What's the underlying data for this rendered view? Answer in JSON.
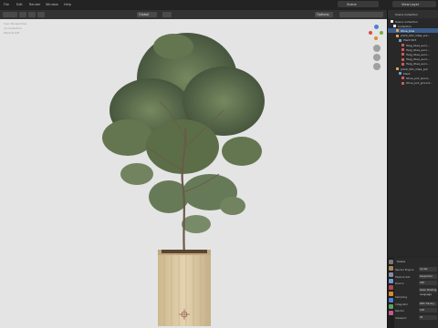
{
  "topbar": {
    "menus": [
      "File",
      "Edit",
      "Render",
      "Window",
      "Help"
    ],
    "view_layer": "View Layer",
    "scene": "Scene"
  },
  "viewport": {
    "mode": "Object Mode",
    "shading": "Global",
    "overlays": "Options",
    "info_lines": [
      "User Perspective",
      "(1) Collection",
      "Objects 0/8"
    ]
  },
  "outliner": {
    "title": "Scene Collection",
    "rows": [
      {
        "label": "Scene Collection",
        "icon": "collection-icon",
        "indent": 1,
        "selected": false
      },
      {
        "label": "Collection",
        "icon": "collection-icon",
        "indent": 2,
        "selected": false
      },
      {
        "label": "Olive_tree",
        "icon": "object-icon",
        "indent": 3,
        "selected": true
      },
      {
        "label": "plant_001_Olea_eur...",
        "icon": "object-icon",
        "indent": 3,
        "selected": false
      },
      {
        "label": "Plant 003",
        "icon": "mesh-icon",
        "indent": 4,
        "selected": false
      },
      {
        "label": "Twig_Olea_euro...",
        "icon": "material-icon",
        "indent": 5,
        "selected": false
      },
      {
        "label": "Twig_Olea_euro...",
        "icon": "material-icon",
        "indent": 5,
        "selected": false
      },
      {
        "label": "Twig_Olea_euro...",
        "icon": "material-icon",
        "indent": 5,
        "selected": false
      },
      {
        "label": "Twig_Olea_euro...",
        "icon": "material-icon",
        "indent": 5,
        "selected": false
      },
      {
        "label": "Twig_Olea_euro...",
        "icon": "material-icon",
        "indent": 5,
        "selected": false
      },
      {
        "label": "plant_001_Olea_pot",
        "icon": "object-icon",
        "indent": 3,
        "selected": false
      },
      {
        "label": "Plant",
        "icon": "mesh-icon",
        "indent": 4,
        "selected": false
      },
      {
        "label": "Olive_pot_wood...",
        "icon": "material-icon",
        "indent": 5,
        "selected": false
      },
      {
        "label": "Olive_pot_ground...",
        "icon": "material-icon",
        "indent": 5,
        "selected": false
      }
    ]
  },
  "properties": {
    "header": "Scene",
    "rows": [
      {
        "label": "Render Engine",
        "value": "Cycles"
      },
      {
        "label": "Feature Set",
        "value": "Supported"
      },
      {
        "label": "Device",
        "value": "CPU"
      },
      {
        "label": "",
        "value": "Open Shading Language"
      },
      {
        "label": "Sampling",
        "value": ""
      },
      {
        "label": "Integrator",
        "value": "Path Tracing"
      },
      {
        "label": "Render",
        "value": "128"
      },
      {
        "label": "Viewport",
        "value": "32"
      }
    ]
  },
  "colors": {
    "viewport_bg": "#e4e4e4",
    "foliage_dark": "#44543a",
    "foliage_light": "#7f9566",
    "pot": "#d9c7a1",
    "selection": "#3c5d8a"
  }
}
